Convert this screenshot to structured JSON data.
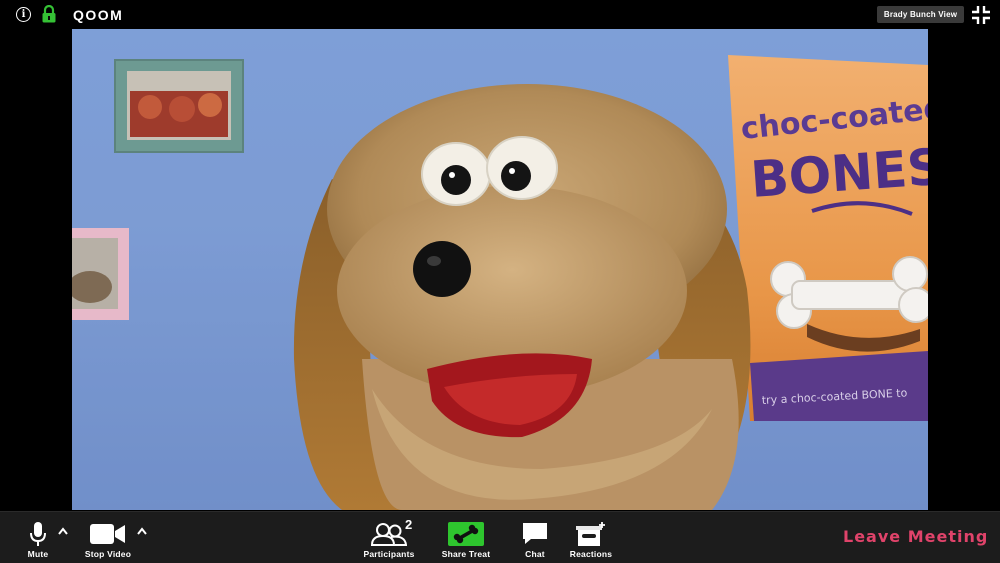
{
  "topbar": {
    "app_title": "QOOM",
    "view_button_label": "Brady Bunch View",
    "icons": {
      "info": "info-icon",
      "lock": "lock-icon",
      "exit_fullscreen": "exit-fullscreen-icon"
    },
    "lock_color": "#35c135"
  },
  "video": {
    "poster_lines": [
      "choc-coated",
      "BONES"
    ],
    "poster_footer": "try a choc-coated BONE to"
  },
  "toolbar": {
    "mute_label": "Mute",
    "stop_video_label": "Stop Video",
    "participants_label": "Participants",
    "participants_count": "2",
    "share_label": "Share Treat",
    "chat_label": "Chat",
    "reactions_label": "Reactions",
    "leave_label": "Leave Meeting",
    "share_color": "#2ec52e",
    "leave_color": "#e0436a"
  }
}
